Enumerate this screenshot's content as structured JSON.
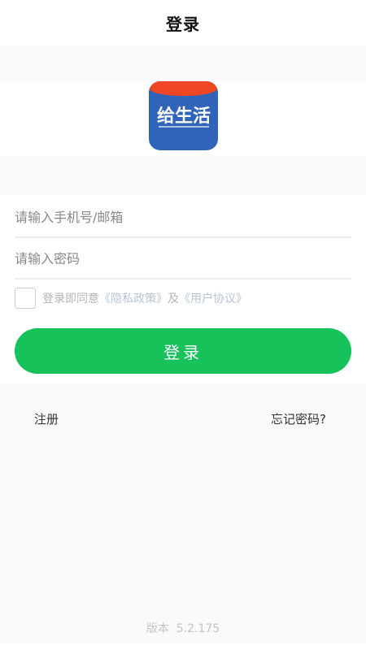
{
  "header": {
    "title": "登录"
  },
  "logo": {
    "text": "给生活"
  },
  "form": {
    "account_placeholder": "请输入手机号/邮箱",
    "password_placeholder": "请输入密码",
    "agreement": {
      "prefix": "登录即同意",
      "privacy_link": "《隐私政策》",
      "conjunction": "及",
      "terms_link": "《用户协议》"
    },
    "login_label": "登录"
  },
  "links": {
    "register": "注册",
    "forgot_password": "忘记密码?"
  },
  "footer": {
    "version_label": "版本",
    "version_number": "5.2.175"
  },
  "colors": {
    "primary_button": "#17c25b",
    "logo_blue": "#2f64b8",
    "logo_red": "#ef4623"
  }
}
